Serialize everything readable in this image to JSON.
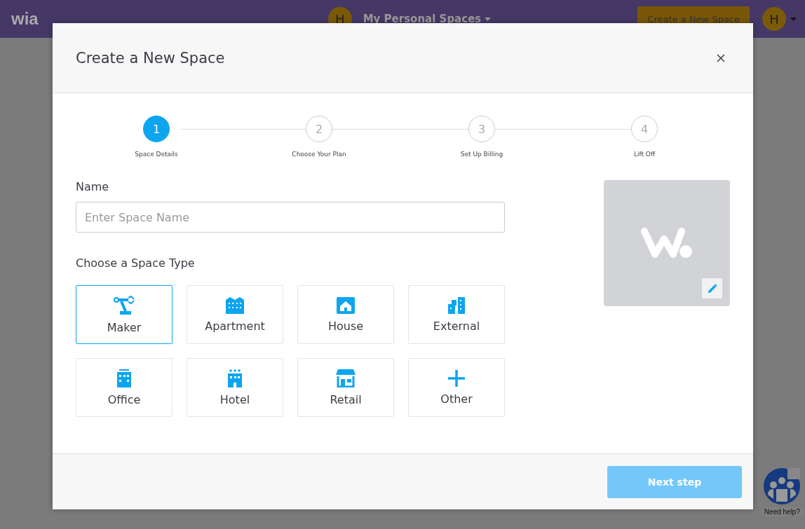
{
  "topbar": {
    "logo": "wia",
    "avatar_letter": "H",
    "spaces_menu": "My Personal Spaces",
    "create_button": "Create a New Space",
    "user_letter": "H"
  },
  "modal": {
    "title": "Create a New Space",
    "steps": [
      {
        "number": "1",
        "label": "Space Details",
        "selected": true
      },
      {
        "number": "2",
        "label": "Choose Your Plan",
        "selected": false
      },
      {
        "number": "3",
        "label": "Set Up Billing",
        "selected": false
      },
      {
        "number": "4",
        "label": "Lift Off",
        "selected": false
      }
    ],
    "name_label": "Name",
    "name_field": {
      "placeholder": "Enter Space Name"
    },
    "type_label": "Choose a Space Type",
    "types": [
      {
        "kind": "maker",
        "label": "Maker",
        "selected": true
      },
      {
        "kind": "apartment",
        "label": "Apartment",
        "selected": false
      },
      {
        "kind": "house",
        "label": "House",
        "selected": false
      },
      {
        "kind": "external",
        "label": "External",
        "selected": false
      },
      {
        "kind": "office",
        "label": "Office",
        "selected": false
      },
      {
        "kind": "hotel",
        "label": "Hotel",
        "selected": false
      },
      {
        "kind": "retail",
        "label": "Retail",
        "selected": false
      },
      {
        "kind": "other",
        "label": "Other",
        "selected": false
      }
    ],
    "next_button": {
      "label": "Next step",
      "disabled": true
    }
  },
  "help": {
    "label": "Need help?"
  }
}
